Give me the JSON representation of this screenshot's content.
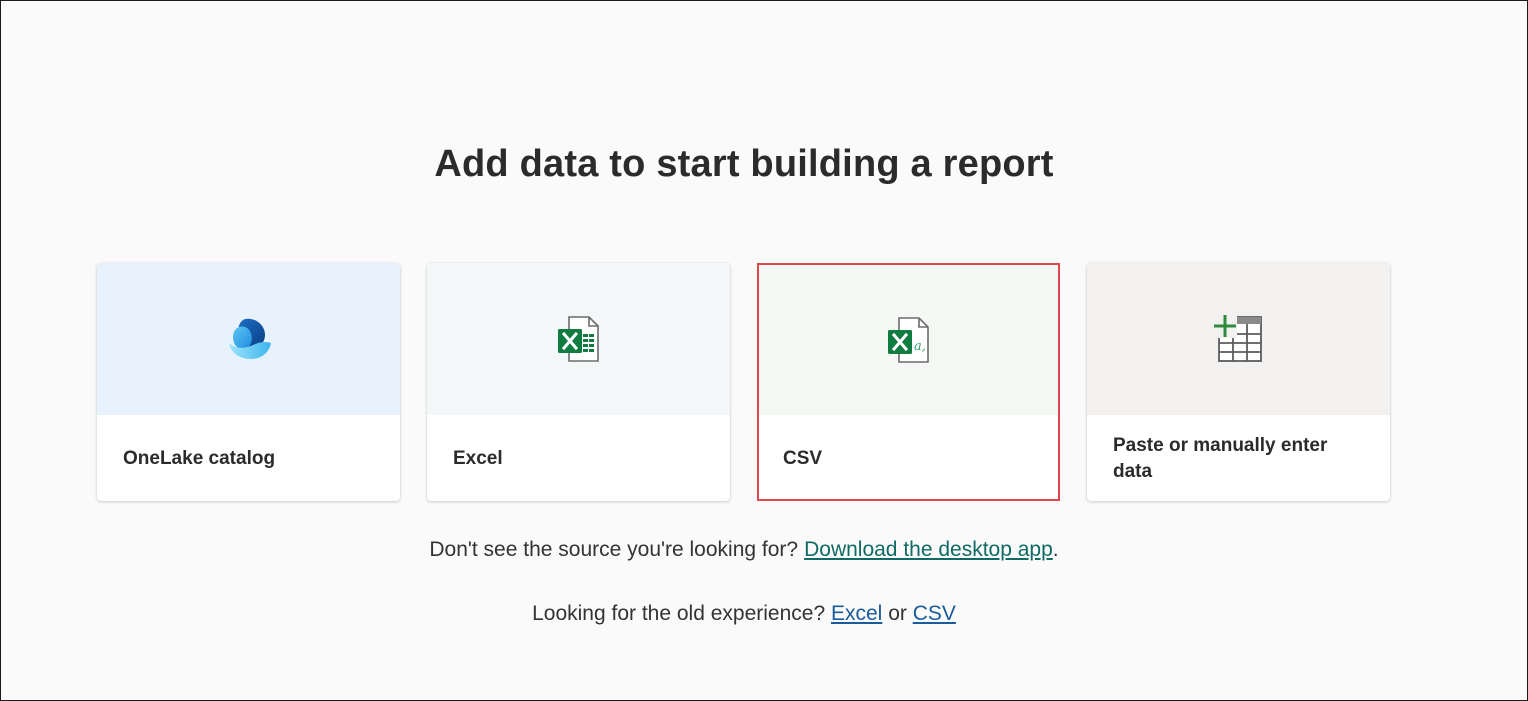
{
  "heading": "Add data to start building a report",
  "cards": [
    {
      "label": "OneLake catalog",
      "icon": "onelake-icon"
    },
    {
      "label": "Excel",
      "icon": "excel-icon"
    },
    {
      "label": "CSV",
      "icon": "csv-icon"
    },
    {
      "label": "Paste or manually enter data",
      "icon": "table-add-icon"
    }
  ],
  "footer": {
    "source_prompt": "Don't see the source you're looking for?",
    "desktop_link": "Download the desktop app",
    "period": ".",
    "old_prompt": "Looking for the old experience?",
    "excel_link": "Excel",
    "or": "or",
    "csv_link": "CSV"
  },
  "colors": {
    "selected_border": "#e0474c",
    "excel_green": "#107c41",
    "link_teal": "#0f6a63",
    "link_blue": "#1a5b9b"
  }
}
